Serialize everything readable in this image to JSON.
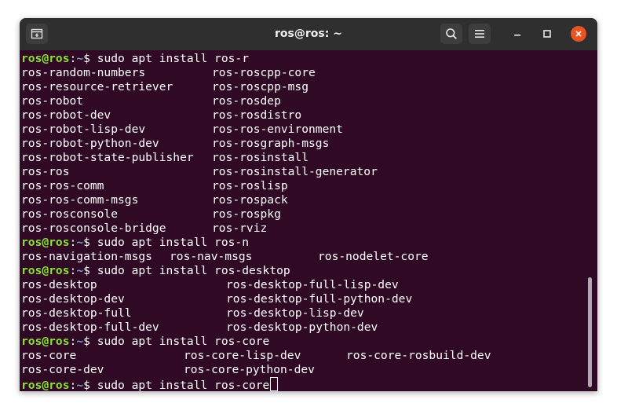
{
  "window": {
    "title": "ros@ros: ~"
  },
  "titlebar": {
    "new_tab_icon": "new-tab-icon",
    "search_icon": "search-icon",
    "menu_icon": "hamburger-menu-icon",
    "minimize_icon": "minimize-icon",
    "maximize_icon": "maximize-icon",
    "close_icon": "close-icon"
  },
  "colors": {
    "background": "#300a24",
    "prompt_user": "#8ae234",
    "prompt_path": "#729fcf",
    "close": "#e95420"
  },
  "prompt": {
    "user": "ros@ros",
    "sep": ":",
    "path": "~",
    "symbol": "$ "
  },
  "terminal": {
    "lines": [
      {
        "cmd": "sudo apt install ros-r"
      },
      {
        "cols": [
          "ros-random-numbers",
          "ros-roscpp-core"
        ]
      },
      {
        "cols": [
          "ros-resource-retriever",
          "ros-roscpp-msg"
        ]
      },
      {
        "cols": [
          "ros-robot",
          "ros-rosdep"
        ]
      },
      {
        "cols": [
          "ros-robot-dev",
          "ros-rosdistro"
        ]
      },
      {
        "cols": [
          "ros-robot-lisp-dev",
          "ros-ros-environment"
        ]
      },
      {
        "cols": [
          "ros-robot-python-dev",
          "ros-rosgraph-msgs"
        ]
      },
      {
        "cols": [
          "ros-robot-state-publisher",
          "ros-rosinstall"
        ]
      },
      {
        "cols": [
          "ros-ros",
          "ros-rosinstall-generator"
        ]
      },
      {
        "cols": [
          "ros-ros-comm",
          "ros-roslisp"
        ]
      },
      {
        "cols": [
          "ros-ros-comm-msgs",
          "ros-rospack"
        ]
      },
      {
        "cols": [
          "ros-rosconsole",
          "ros-rospkg"
        ]
      },
      {
        "cols": [
          "ros-rosconsole-bridge",
          "ros-rviz"
        ]
      },
      {
        "cmd": "sudo apt install ros-n"
      },
      {
        "cols": [
          "ros-navigation-msgs",
          "ros-nav-msgs",
          "ros-nodelet-core"
        ]
      },
      {
        "cmd": "sudo apt install ros-desktop"
      },
      {
        "cols": [
          "ros-desktop",
          "ros-desktop-full-lisp-dev"
        ]
      },
      {
        "cols": [
          "ros-desktop-dev",
          "ros-desktop-full-python-dev"
        ]
      },
      {
        "cols": [
          "ros-desktop-full",
          "ros-desktop-lisp-dev"
        ]
      },
      {
        "cols": [
          "ros-desktop-full-dev",
          "ros-desktop-python-dev"
        ]
      },
      {
        "cmd": "sudo apt install ros-core"
      },
      {
        "cols": [
          "ros-core",
          "ros-core-lisp-dev",
          "ros-core-rosbuild-dev"
        ]
      },
      {
        "cols": [
          "ros-core-dev",
          "ros-core-python-dev"
        ]
      },
      {
        "cmd": "sudo apt install ros-core",
        "cursor": true
      }
    ]
  }
}
